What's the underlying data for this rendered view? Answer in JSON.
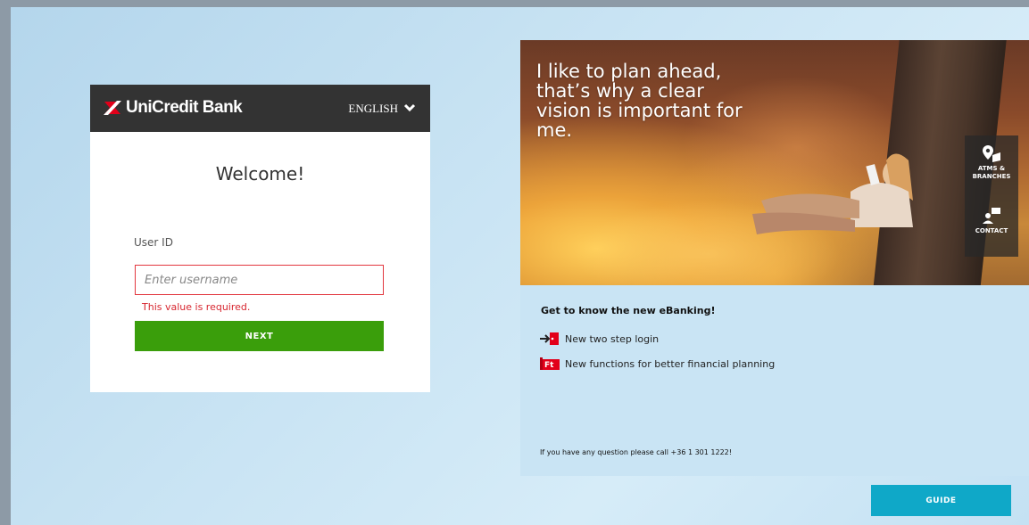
{
  "login": {
    "brand": "UniCredit Bank",
    "language": "ENGLISH",
    "welcome": "Welcome!",
    "userid_label": "User ID",
    "username_placeholder": "Enter username",
    "error": "This value is required.",
    "next_label": "NEXT"
  },
  "promo": {
    "hero_text": "I like to plan ahead, that’s why a clear vision is important for me.",
    "side_nav": [
      {
        "label_line1": "ATMS &",
        "label_line2": "BRANCHES",
        "icon": "map-marker-icon"
      },
      {
        "label_line1": "CONTACT",
        "label_line2": "",
        "icon": "contact-person-icon"
      }
    ],
    "heading": "Get to know the new eBanking!",
    "features": [
      {
        "label": "New two step login",
        "icon": "login-arrow-icon"
      },
      {
        "label": "New functions for better financial planning",
        "icon": "ft-badge-icon"
      }
    ],
    "contact_line": "If you have any question please call +36 1 301 1222!"
  },
  "guide_label": "GUIDE",
  "colors": {
    "header_bg": "#333333",
    "next_green": "#3a9e0b",
    "error_red": "#d7262f",
    "guide_teal": "#0fa8c8",
    "brand_red": "#e2001a"
  }
}
